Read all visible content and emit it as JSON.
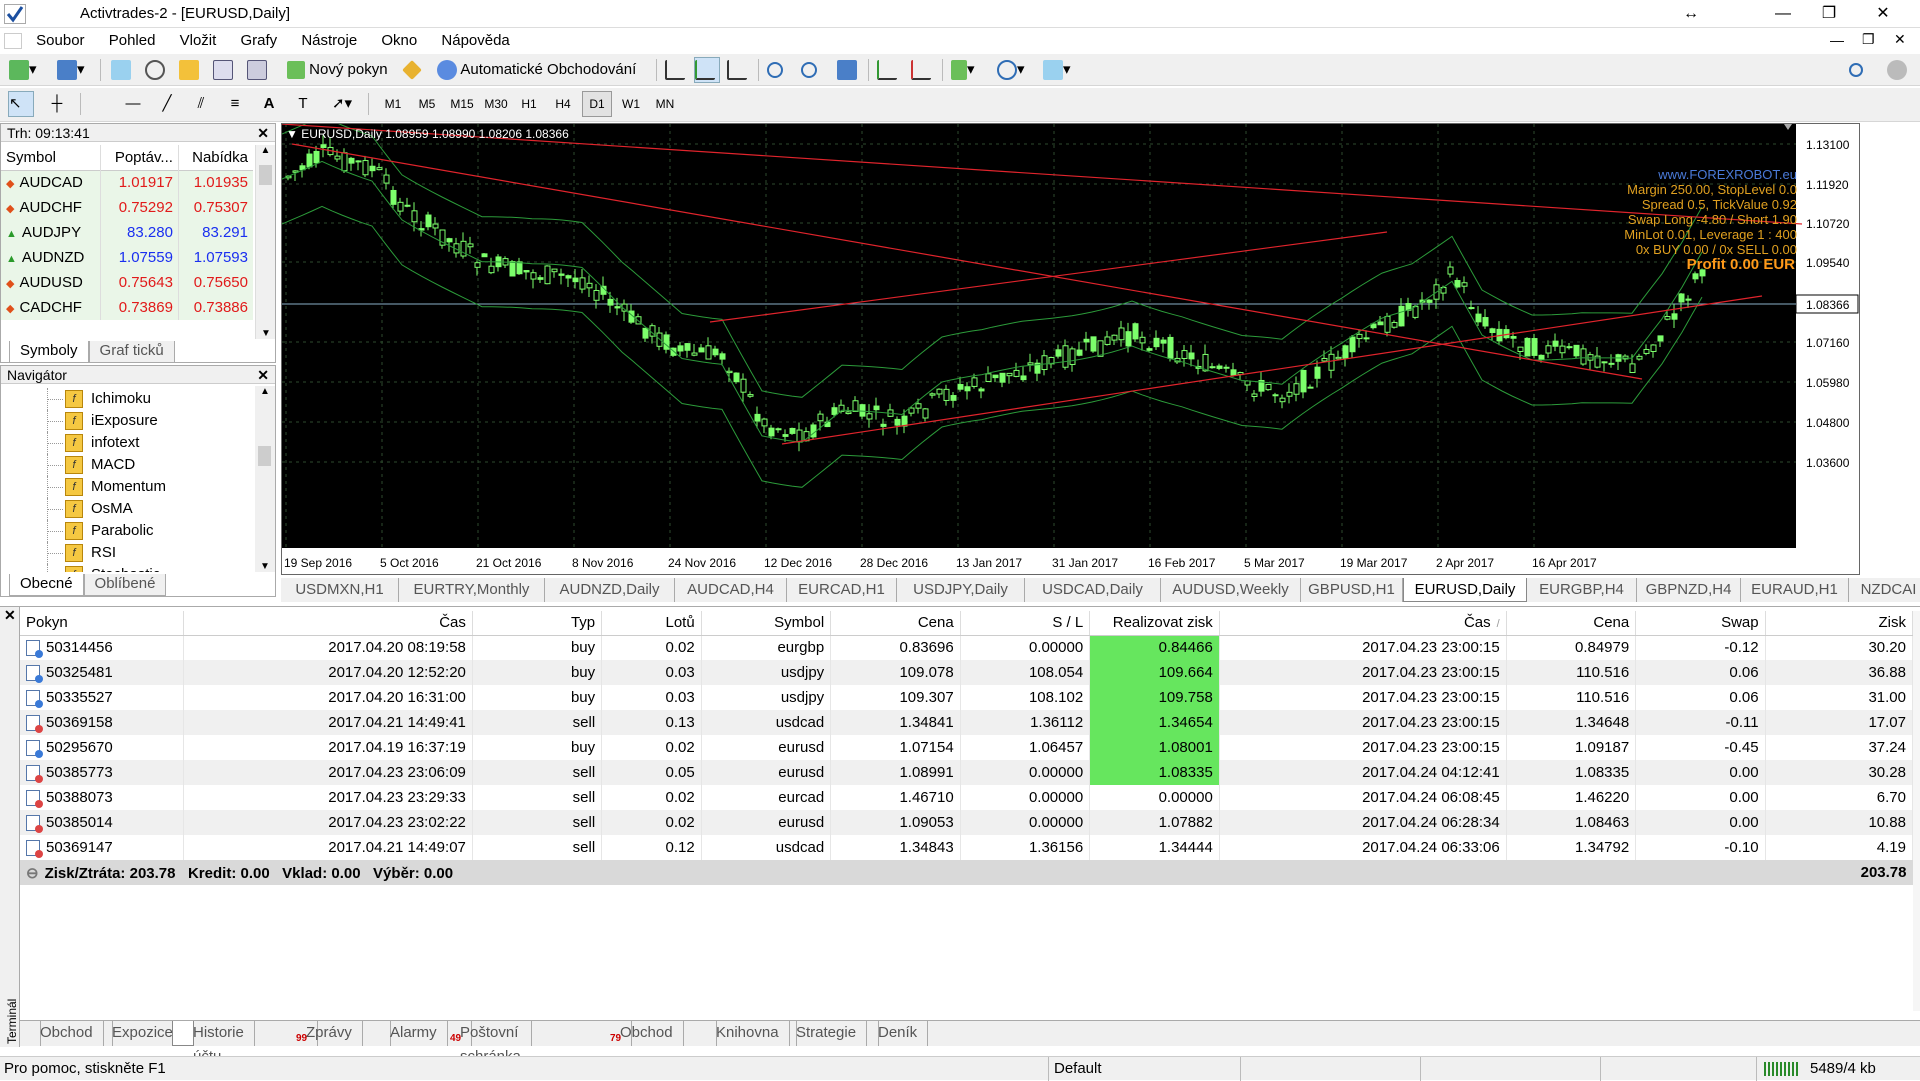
{
  "window": {
    "title": "Activtrades-2 - [EURUSD,Daily]",
    "min": "—",
    "restore": "❐",
    "close": "✕",
    "extra": "↔"
  },
  "menu": [
    "Soubor",
    "Pohled",
    "Vložit",
    "Grafy",
    "Nástroje",
    "Okno",
    "Nápověda"
  ],
  "toolbar": {
    "new_order": "Nový pokyn",
    "auto_trading": "Automatické Obchodování"
  },
  "timeframes": [
    "M1",
    "M5",
    "M15",
    "M30",
    "H1",
    "H4",
    "D1",
    "W1",
    "MN"
  ],
  "active_timeframe": "D1",
  "market_watch": {
    "header": "Trh: 09:13:41",
    "columns": [
      "Symbol",
      "Poptáv...",
      "Nabídka"
    ],
    "rows": [
      {
        "symbol": "AUDCAD",
        "bid": "1.01917",
        "ask": "1.01935",
        "dir": "down"
      },
      {
        "symbol": "AUDCHF",
        "bid": "0.75292",
        "ask": "0.75307",
        "dir": "down"
      },
      {
        "symbol": "AUDJPY",
        "bid": "83.280",
        "ask": "83.291",
        "dir": "up"
      },
      {
        "symbol": "AUDNZD",
        "bid": "1.07559",
        "ask": "1.07593",
        "dir": "up"
      },
      {
        "symbol": "AUDUSD",
        "bid": "0.75643",
        "ask": "0.75650",
        "dir": "down"
      },
      {
        "symbol": "CADCHF",
        "bid": "0.73869",
        "ask": "0.73886",
        "dir": "down"
      }
    ],
    "tabs": [
      "Symboly",
      "Graf ticků"
    ]
  },
  "navigator": {
    "header": "Navigátor",
    "items": [
      "Ichimoku",
      "iExposure",
      "infotext",
      "MACD",
      "Momentum",
      "OsMA",
      "Parabolic",
      "RSI",
      "Stochastic"
    ],
    "tabs": [
      "Obecné",
      "Oblíbené"
    ]
  },
  "chart": {
    "header": "EURUSD,Daily  1.08959 1.08990 1.08206 1.08366",
    "price_labels": [
      "1.13100",
      "1.11920",
      "1.10720",
      "1.09540",
      "1.08366",
      "1.07160",
      "1.05980",
      "1.04800",
      "1.03600"
    ],
    "date_labels": [
      "19 Sep 2016",
      "5 Oct 2016",
      "21 Oct 2016",
      "8 Nov 2016",
      "24 Nov 2016",
      "12 Dec 2016",
      "28 Dec 2016",
      "13 Jan 2017",
      "31 Jan 2017",
      "16 Feb 2017",
      "5 Mar 2017",
      "19 Mar 2017",
      "2 Apr 2017",
      "16 Apr 2017"
    ],
    "info": [
      "www.FOREXROBOT.eu",
      "Margin 250.00, StopLevel 0.0",
      "Spread 0.5, TickValue 0.92",
      "Swap Long -4.80 / Short 1.90",
      "MinLot 0.01, Leverage 1 : 400",
      "0x BUY 0.00 / 0x SELL 0.00"
    ],
    "profit": "Profit 0.00 EUR",
    "colors": {
      "bg": "#000000",
      "bull": "#7cff6b",
      "band": "#2c9b3a",
      "line": "#e0242c",
      "grid": "#2e4a2e"
    }
  },
  "chart_tabs": [
    "USDMXN,H1",
    "EURTRY,Monthly",
    "AUDNZD,Daily",
    "AUDCAD,H4",
    "EURCAD,H1",
    "USDJPY,Daily",
    "USDCAD,Daily",
    "AUDUSD,Weekly",
    "GBPUSD,H1",
    "EURUSD,Daily",
    "EURGBP,H4",
    "GBPNZD,H4",
    "EURAUD,H1",
    "NZDCAI"
  ],
  "active_chart_tab": "EURUSD,Daily",
  "history": {
    "columns": [
      "Pokyn",
      "Čas",
      "Typ",
      "Lotů",
      "Symbol",
      "Cena",
      "S / L",
      "Realizovat zisk",
      "Čas",
      "Cena",
      "Swap",
      "Zisk"
    ],
    "rows": [
      {
        "id": "50314456",
        "t1": "2017.04.20 08:19:58",
        "type": "buy",
        "lots": "0.02",
        "sym": "eurgbp",
        "p1": "0.83696",
        "sl": "0.00000",
        "tp": "0.84466",
        "t2": "2017.04.23 23:00:15",
        "p2": "0.84979",
        "swap": "-0.12",
        "profit": "30.20",
        "hl": true
      },
      {
        "id": "50325481",
        "t1": "2017.04.20 12:52:20",
        "type": "buy",
        "lots": "0.03",
        "sym": "usdjpy",
        "p1": "109.078",
        "sl": "108.054",
        "tp": "109.664",
        "t2": "2017.04.23 23:00:15",
        "p2": "110.516",
        "swap": "0.06",
        "profit": "36.88",
        "hl": true
      },
      {
        "id": "50335527",
        "t1": "2017.04.20 16:31:00",
        "type": "buy",
        "lots": "0.03",
        "sym": "usdjpy",
        "p1": "109.307",
        "sl": "108.102",
        "tp": "109.758",
        "t2": "2017.04.23 23:00:15",
        "p2": "110.516",
        "swap": "0.06",
        "profit": "31.00",
        "hl": true
      },
      {
        "id": "50369158",
        "t1": "2017.04.21 14:49:41",
        "type": "sell",
        "lots": "0.13",
        "sym": "usdcad",
        "p1": "1.34841",
        "sl": "1.36112",
        "tp": "1.34654",
        "t2": "2017.04.23 23:00:15",
        "p2": "1.34648",
        "swap": "-0.11",
        "profit": "17.07",
        "hl": true
      },
      {
        "id": "50295670",
        "t1": "2017.04.19 16:37:19",
        "type": "buy",
        "lots": "0.02",
        "sym": "eurusd",
        "p1": "1.07154",
        "sl": "1.06457",
        "tp": "1.08001",
        "t2": "2017.04.23 23:00:15",
        "p2": "1.09187",
        "swap": "-0.45",
        "profit": "37.24",
        "hl": true
      },
      {
        "id": "50385773",
        "t1": "2017.04.23 23:06:09",
        "type": "sell",
        "lots": "0.05",
        "sym": "eurusd",
        "p1": "1.08991",
        "sl": "0.00000",
        "tp": "1.08335",
        "t2": "2017.04.24 04:12:41",
        "p2": "1.08335",
        "swap": "0.00",
        "profit": "30.28",
        "hl": true
      },
      {
        "id": "50388073",
        "t1": "2017.04.23 23:29:33",
        "type": "sell",
        "lots": "0.02",
        "sym": "eurcad",
        "p1": "1.46710",
        "sl": "0.00000",
        "tp": "0.00000",
        "t2": "2017.04.24 06:08:45",
        "p2": "1.46220",
        "swap": "0.00",
        "profit": "6.70",
        "hl": false
      },
      {
        "id": "50385014",
        "t1": "2017.04.23 23:02:22",
        "type": "sell",
        "lots": "0.02",
        "sym": "eurusd",
        "p1": "1.09053",
        "sl": "0.00000",
        "tp": "1.07882",
        "t2": "2017.04.24 06:28:34",
        "p2": "1.08463",
        "swap": "0.00",
        "profit": "10.88",
        "hl": false
      },
      {
        "id": "50369147",
        "t1": "2017.04.21 14:49:07",
        "type": "sell",
        "lots": "0.12",
        "sym": "usdcad",
        "p1": "1.34843",
        "sl": "1.36156",
        "tp": "1.34444",
        "t2": "2017.04.24 06:33:06",
        "p2": "1.34792",
        "swap": "-0.10",
        "profit": "4.19",
        "hl": false
      }
    ],
    "summary": "Zisk/Ztráta: 203.78   Kredit: 0.00   Vklad: 0.00   Výběr: 0.00",
    "summary_total": "203.78",
    "highlight_color": "#66e65e"
  },
  "terminal": {
    "side_label": "Terminál",
    "tabs": [
      {
        "label": "Obchod",
        "badge": ""
      },
      {
        "label": "Expozice",
        "badge": ""
      },
      {
        "label": "Historie účtu",
        "badge": ""
      },
      {
        "label": "Zprávy",
        "badge": "99"
      },
      {
        "label": "Alarmy",
        "badge": ""
      },
      {
        "label": "Poštovní schránka",
        "badge": "49"
      },
      {
        "label": "Obchod",
        "badge": "79"
      },
      {
        "label": "Knihovna",
        "badge": ""
      },
      {
        "label": "Strategie",
        "badge": ""
      },
      {
        "label": "Deník",
        "badge": ""
      }
    ],
    "active_tab": "Historie účtu"
  },
  "status": {
    "help": "Pro pomoc, stiskněte F1",
    "profile": "Default",
    "traffic": "5489/4 kb"
  }
}
